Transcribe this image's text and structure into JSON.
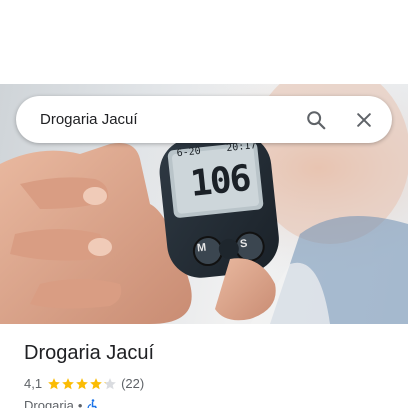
{
  "search": {
    "query": "Drogaria Jacuí",
    "icons": {
      "search": "search-icon",
      "close": "close-icon"
    }
  },
  "hero": {
    "meter_time_left": "6-20",
    "meter_time_right": "20:17",
    "meter_reading": "106",
    "meter_button_left": "M",
    "meter_button_right": "S"
  },
  "place": {
    "title": "Drogaria Jacuí",
    "rating": "4,1",
    "stars_value": 4.1,
    "review_count": "(22)",
    "category": "Drogaria",
    "separator": "•",
    "accessibility_icon": "wheelchair-icon"
  },
  "colors": {
    "star": "#fbbc04",
    "star_empty": "#dadce0",
    "accessibility_icon": "#1a73e8"
  }
}
